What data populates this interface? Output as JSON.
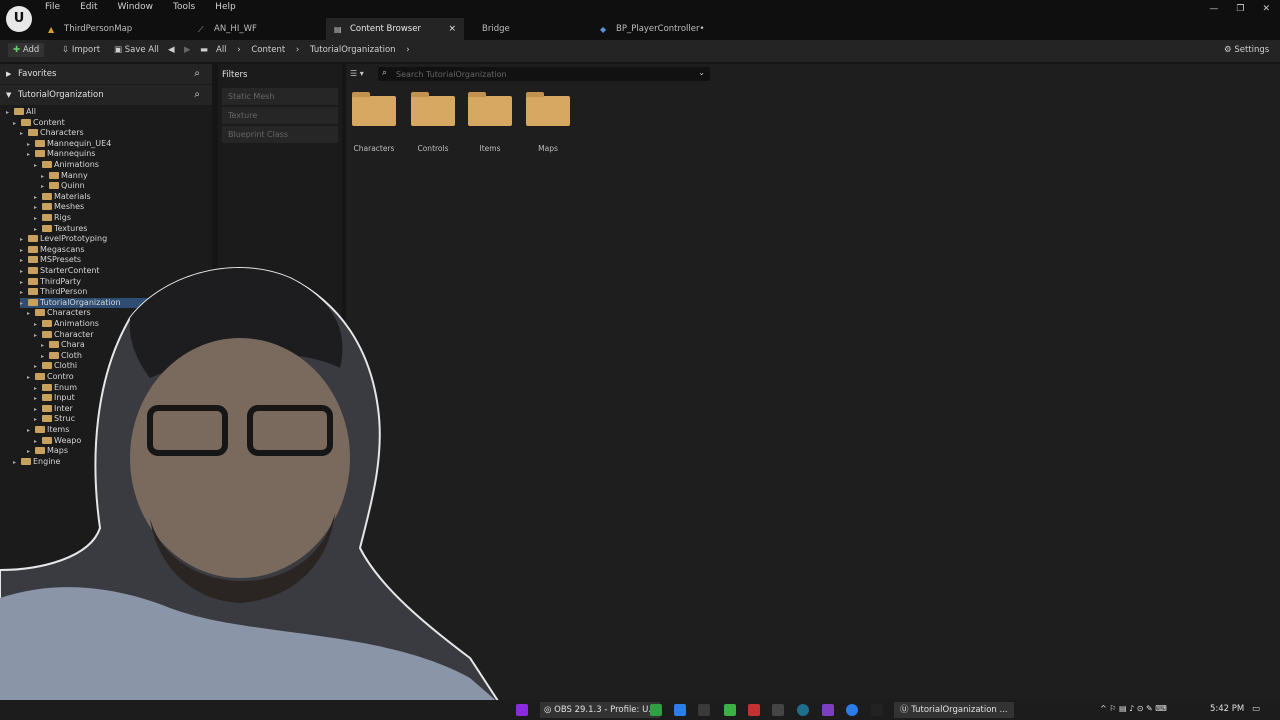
{
  "menu": [
    "File",
    "Edit",
    "Window",
    "Tools",
    "Help"
  ],
  "tabs": [
    {
      "label": "ThirdPersonMap",
      "active": false
    },
    {
      "label": "AN_HI_WF",
      "active": false
    },
    {
      "label": "Content Browser",
      "active": true
    },
    {
      "label": "Bridge",
      "active": false
    },
    {
      "label": "BP_PlayerController•",
      "active": false
    }
  ],
  "toolbar": {
    "add": "Add",
    "import": "Import",
    "save_all": "Save All",
    "breadcrumb": [
      "All",
      "Content",
      "TutorialOrganization"
    ],
    "settings": "Settings"
  },
  "favorites": {
    "label": "Favorites"
  },
  "tree_header": {
    "label": "TutorialOrganization"
  },
  "tree": [
    {
      "label": "All",
      "depth": 0
    },
    {
      "label": "Content",
      "depth": 1
    },
    {
      "label": "Characters",
      "depth": 2
    },
    {
      "label": "Mannequin_UE4",
      "depth": 3
    },
    {
      "label": "Mannequins",
      "depth": 3
    },
    {
      "label": "Animations",
      "depth": 4
    },
    {
      "label": "Manny",
      "depth": 5
    },
    {
      "label": "Quinn",
      "depth": 5
    },
    {
      "label": "Materials",
      "depth": 4
    },
    {
      "label": "Meshes",
      "depth": 4
    },
    {
      "label": "Rigs",
      "depth": 4
    },
    {
      "label": "Textures",
      "depth": 4
    },
    {
      "label": "LevelPrototyping",
      "depth": 2
    },
    {
      "label": "Megascans",
      "depth": 2
    },
    {
      "label": "MSPresets",
      "depth": 2
    },
    {
      "label": "StarterContent",
      "depth": 2
    },
    {
      "label": "ThirdParty",
      "depth": 2
    },
    {
      "label": "ThirdPerson",
      "depth": 2
    },
    {
      "label": "TutorialOrganization",
      "depth": 2
    },
    {
      "label": "Characters",
      "depth": 3
    },
    {
      "label": "Animations",
      "depth": 4
    },
    {
      "label": "Character",
      "depth": 4
    },
    {
      "label": "Chara",
      "depth": 5
    },
    {
      "label": "Cloth",
      "depth": 5
    },
    {
      "label": "Clothi",
      "depth": 4
    },
    {
      "label": "Contro",
      "depth": 3
    },
    {
      "label": "Enum",
      "depth": 4
    },
    {
      "label": "Input",
      "depth": 4
    },
    {
      "label": "Inter",
      "depth": 4
    },
    {
      "label": "Struc",
      "depth": 4
    },
    {
      "label": "Items",
      "depth": 3
    },
    {
      "label": "Weapo",
      "depth": 4
    },
    {
      "label": "Maps",
      "depth": 3
    },
    {
      "label": "Engine",
      "depth": 1
    }
  ],
  "filters": {
    "label": "Filters",
    "items": [
      "Static Mesh",
      "Texture",
      "Blueprint Class"
    ]
  },
  "search": {
    "placeholder": "Search TutorialOrganization"
  },
  "assets": [
    "Characters",
    "Controls",
    "Items",
    "Maps"
  ],
  "taskbar": {
    "obs": "OBS 29.1.3 - Profile: U...",
    "active_window": "TutorialOrganization ...",
    "time": "5:42 PM"
  },
  "colors": {
    "folder": "#d6a862",
    "selection": "#2f4d73",
    "background": "#1e1e1e"
  }
}
